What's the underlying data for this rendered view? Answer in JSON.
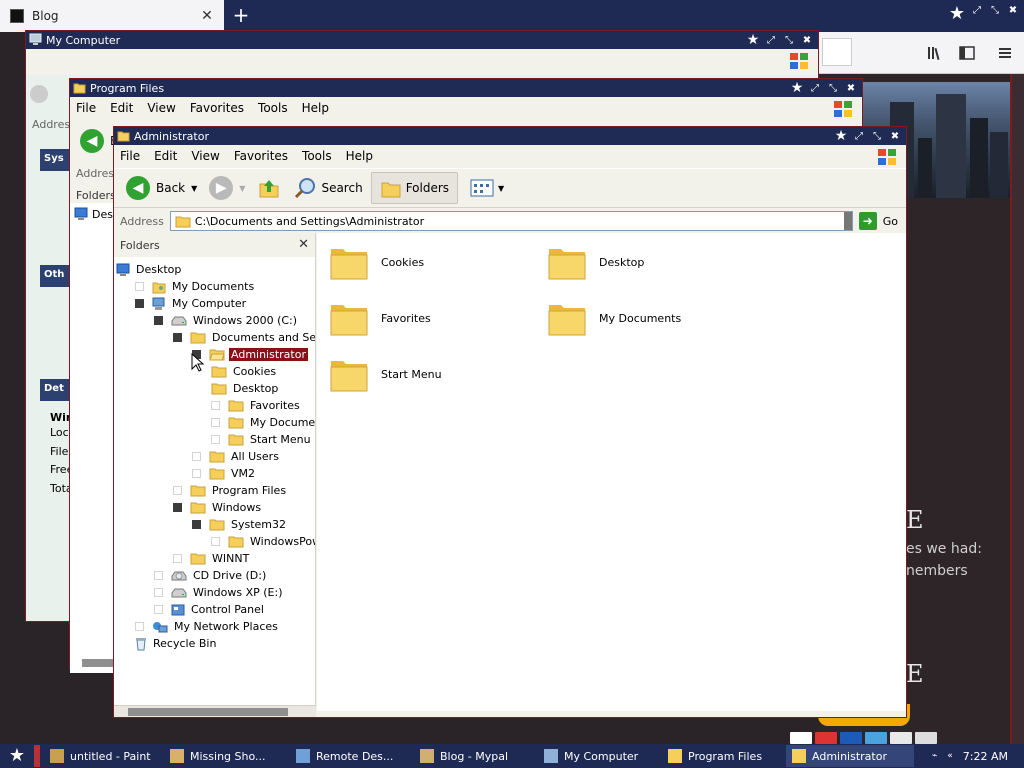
{
  "browser": {
    "tab_title": "Blog",
    "tab_close": "✕",
    "new_tab": "+",
    "window_controls": [
      "★",
      "⤢",
      "⤡",
      "✖"
    ],
    "site": {
      "heading_1": "E",
      "text_1": "es we had:",
      "text_2": "nembers",
      "heading_2": "E"
    }
  },
  "my_computer_window": {
    "title": "My Computer",
    "address_label": "Address",
    "sidebar": [
      "Sys",
      "Oth",
      "Det"
    ],
    "details_lines": [
      "Win",
      "Loc",
      "File",
      "Free",
      "Tota"
    ]
  },
  "program_files_window": {
    "title": "Program Files",
    "menu": [
      "File",
      "Edit",
      "View",
      "Favorites",
      "Tools",
      "Help"
    ],
    "back_label": "B",
    "address_label": "Address",
    "folders_label": "Folders",
    "tree_partial": "Des"
  },
  "administrator_window": {
    "title": "Administrator",
    "menu": [
      "File",
      "Edit",
      "View",
      "Favorites",
      "Tools",
      "Help"
    ],
    "toolbar": {
      "back": "Back",
      "search": "Search",
      "folders": "Folders"
    },
    "address": {
      "label": "Address",
      "value": "C:\\Documents and Settings\\Administrator",
      "go": "Go"
    },
    "folders_pane": {
      "title": "Folders",
      "close": "✕"
    },
    "tree": [
      {
        "label": "Desktop",
        "level": 0,
        "exp": "none",
        "icon": "desktop"
      },
      {
        "label": "My Documents",
        "level": 1,
        "exp": "empty",
        "icon": "mydocs"
      },
      {
        "label": "My Computer",
        "level": 1,
        "exp": "filled",
        "icon": "computer"
      },
      {
        "label": "Windows 2000 (C:)",
        "level": 2,
        "exp": "filled",
        "icon": "drive"
      },
      {
        "label": "Documents and Settings",
        "level": 3,
        "exp": "filled",
        "icon": "folder"
      },
      {
        "label": "Administrator",
        "level": 4,
        "exp": "filled",
        "icon": "folder-open",
        "selected": true
      },
      {
        "label": "Cookies",
        "level": 5,
        "exp": "none",
        "icon": "folder"
      },
      {
        "label": "Desktop",
        "level": 5,
        "exp": "none",
        "icon": "folder"
      },
      {
        "label": "Favorites",
        "level": 5,
        "exp": "empty",
        "icon": "folder"
      },
      {
        "label": "My Documents",
        "level": 5,
        "exp": "empty",
        "icon": "folder"
      },
      {
        "label": "Start Menu",
        "level": 5,
        "exp": "empty",
        "icon": "folder"
      },
      {
        "label": "All Users",
        "level": 4,
        "exp": "empty",
        "icon": "folder"
      },
      {
        "label": "VM2",
        "level": 4,
        "exp": "empty",
        "icon": "folder"
      },
      {
        "label": "Program Files",
        "level": 3,
        "exp": "empty",
        "icon": "folder"
      },
      {
        "label": "Windows",
        "level": 3,
        "exp": "filled",
        "icon": "folder"
      },
      {
        "label": "System32",
        "level": 4,
        "exp": "filled",
        "icon": "folder"
      },
      {
        "label": "WindowsPowerSh",
        "level": 5,
        "exp": "empty",
        "icon": "folder"
      },
      {
        "label": "WINNT",
        "level": 3,
        "exp": "empty",
        "icon": "folder"
      },
      {
        "label": "CD Drive (D:)",
        "level": 2,
        "exp": "empty",
        "icon": "cd"
      },
      {
        "label": "Windows XP (E:)",
        "level": 2,
        "exp": "empty",
        "icon": "drive"
      },
      {
        "label": "Control Panel",
        "level": 2,
        "exp": "empty",
        "icon": "control"
      },
      {
        "label": "My Network Places",
        "level": 1,
        "exp": "empty",
        "icon": "network"
      },
      {
        "label": "Recycle Bin",
        "level": 1,
        "exp": "none",
        "icon": "recycle"
      }
    ],
    "content_items": [
      "Cookies",
      "Desktop",
      "Favorites",
      "My Documents",
      "Start Menu"
    ]
  },
  "taskbar": {
    "items": [
      {
        "label": "untitled - Paint",
        "active": false
      },
      {
        "label": "Missing Sho...",
        "active": false
      },
      {
        "label": "Remote Des...",
        "active": false
      },
      {
        "label": "Blog - Mypal",
        "active": false
      },
      {
        "label": "My Computer",
        "active": false
      },
      {
        "label": "Program Files",
        "active": false
      },
      {
        "label": "Administrator",
        "active": true
      }
    ],
    "clock": "7:22 AM"
  },
  "colors": {
    "titlebar": "#1f2b55",
    "window_border": "#7a1a24",
    "folder_yellow": "#f5cf5a",
    "selection": "#8b0f1a",
    "taskbar": "#1e2a54"
  }
}
